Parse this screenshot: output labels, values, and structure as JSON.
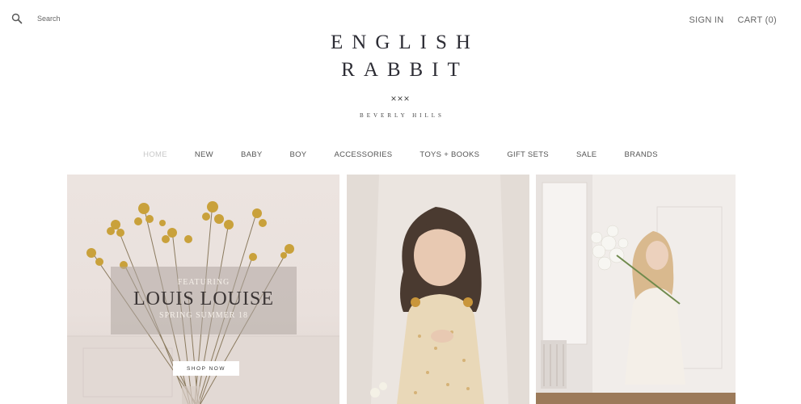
{
  "header": {
    "search": {
      "placeholder": "Search",
      "icon": "search-icon"
    },
    "sign_in": "SIGN IN",
    "cart": "CART (0)"
  },
  "logo": {
    "line1": "ENGLISH",
    "line2": "RABBIT",
    "crosses": "×××",
    "location": "BEVERLY HILLS"
  },
  "nav": {
    "active": "HOME",
    "items": [
      "HOME",
      "NEW",
      "BABY",
      "BOY",
      "ACCESSORIES",
      "TOYS + BOOKS",
      "GIFT SETS",
      "SALE",
      "BRANDS"
    ]
  },
  "hero": {
    "featuring": "FEATURING",
    "brand": "LOUIS LOUISE",
    "season": "SPRING SUMMER 18",
    "cta": "SHOP NOW"
  },
  "colors": {
    "text": "#555555",
    "logo": "#2d2d35",
    "nav_active": "#c8c8c8",
    "flower": "#c9a13b"
  }
}
